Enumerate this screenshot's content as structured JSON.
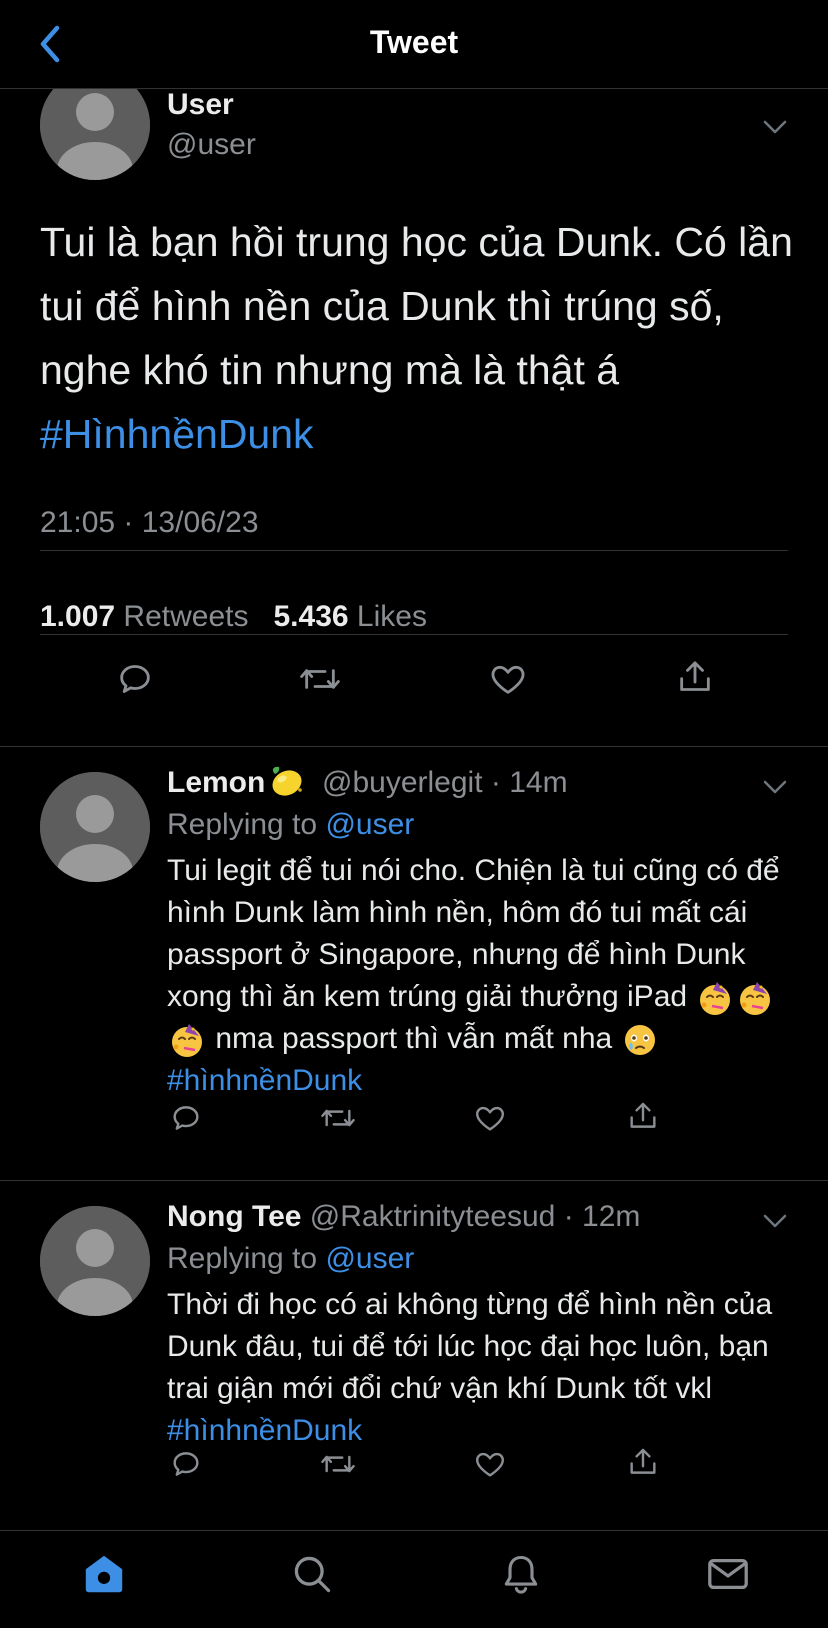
{
  "header": {
    "title": "Tweet"
  },
  "main_tweet": {
    "name": "User",
    "handle": "@user",
    "text": "Tui là bạn hồi trung học của Dunk. Có lần tui để hình nền của Dunk thì trúng số, nghe khó tin nhưng mà là thật á",
    "hashtag": "#HìnhnềnDunk",
    "timestamp": "21:05 · 13/06/23",
    "retweets_count": "1.007",
    "retweets_label": "Retweets",
    "likes_count": "5.436",
    "likes_label": "Likes"
  },
  "replies": [
    {
      "name": "Lemon",
      "name_emoji": "lemon",
      "handle": "@buyerlegit",
      "time": "14m",
      "replying_label": "Replying to",
      "replying_to": "@user",
      "text_part1": "Tui legit để tui nói cho. Chiện là tui cũng có để hình Dunk làm hình nền, hôm đó tui mất cái passport ở Singapore, nhưng để hình Dunk xong thì ăn kem trúng giải thưởng iPad",
      "emojis_party": [
        "partying-face",
        "partying-face",
        "partying-face"
      ],
      "text_part2": "nma passport thì vẫn mất nha",
      "emoji_sad": "face-holding-back-tears",
      "hashtag": "#hìnhnềnDunk"
    },
    {
      "name": "Nong Tee",
      "handle": "@Raktrinityteesud",
      "time": "12m",
      "replying_label": "Replying to",
      "replying_to": "@user",
      "text": "Thời đi học có ai không từng để hình nền của Dunk đâu, tui để tới lúc học đại học luôn, bạn trai giận mới đổi chứ vận khí Dunk tốt vkl",
      "hashtag": "#hìnhnềnDunk"
    }
  ],
  "separator": "·",
  "colors": {
    "background": "#000000",
    "accent": "#3d8fe6",
    "text": "#e7e9ea",
    "muted": "#8b8f93",
    "divider": "#2f3336"
  },
  "tabbar": {
    "items": [
      "home-icon",
      "search-icon",
      "notifications-icon",
      "messages-icon"
    ],
    "active": "home-icon"
  }
}
